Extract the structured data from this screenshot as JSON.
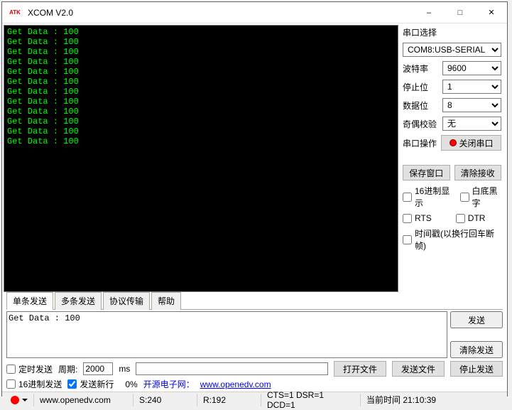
{
  "window": {
    "title": "XCOM V2.0",
    "icon_text": "ATK"
  },
  "terminal": {
    "lines": "Get Data : 100\nGet Data : 100\nGet Data : 100\nGet Data : 100\nGet Data : 100\nGet Data : 100\nGet Data : 100\nGet Data : 100\nGet Data : 100\nGet Data : 100\nGet Data : 100\nGet Data : 100"
  },
  "serial": {
    "section_label": "串口选择",
    "port_value": "COM8:USB-SERIAL",
    "baud_label": "波特率",
    "baud_value": "9600",
    "stop_label": "停止位",
    "stop_value": "1",
    "data_label": "数据位",
    "data_value": "8",
    "parity_label": "奇偶校验",
    "parity_value": "无",
    "op_label": "串口操作",
    "op_button": "关闭串口",
    "save_window": "保存窗口",
    "clear_recv": "清除接收",
    "hex_display": "16进制显示",
    "white_black": "白底黑字",
    "rts": "RTS",
    "dtr": "DTR",
    "timestamp": "时间戳(以换行回车断帧)"
  },
  "tabs": {
    "single": "单条发送",
    "multi": "多条发送",
    "protocol": "协议传输",
    "help": "帮助"
  },
  "send": {
    "content": "Get Data : 100",
    "send_btn": "发送",
    "clear_send": "清除发送"
  },
  "options": {
    "timed_send": "定时发送",
    "period_label": "周期:",
    "period_value": "2000",
    "period_unit": "ms",
    "open_file": "打开文件",
    "send_file": "发送文件",
    "stop_send": "停止发送",
    "hex_send": "16进制发送",
    "send_newline": "发送新行",
    "progress_pct": "0%",
    "link_label": "开源电子网：",
    "link_url": "www.openedv.com"
  },
  "status": {
    "site": "www.openedv.com",
    "s": "S:240",
    "r": "R:192",
    "signals": "CTS=1 DSR=1 DCD=1",
    "time_label": "当前时间",
    "time_value": "21:10:39"
  }
}
